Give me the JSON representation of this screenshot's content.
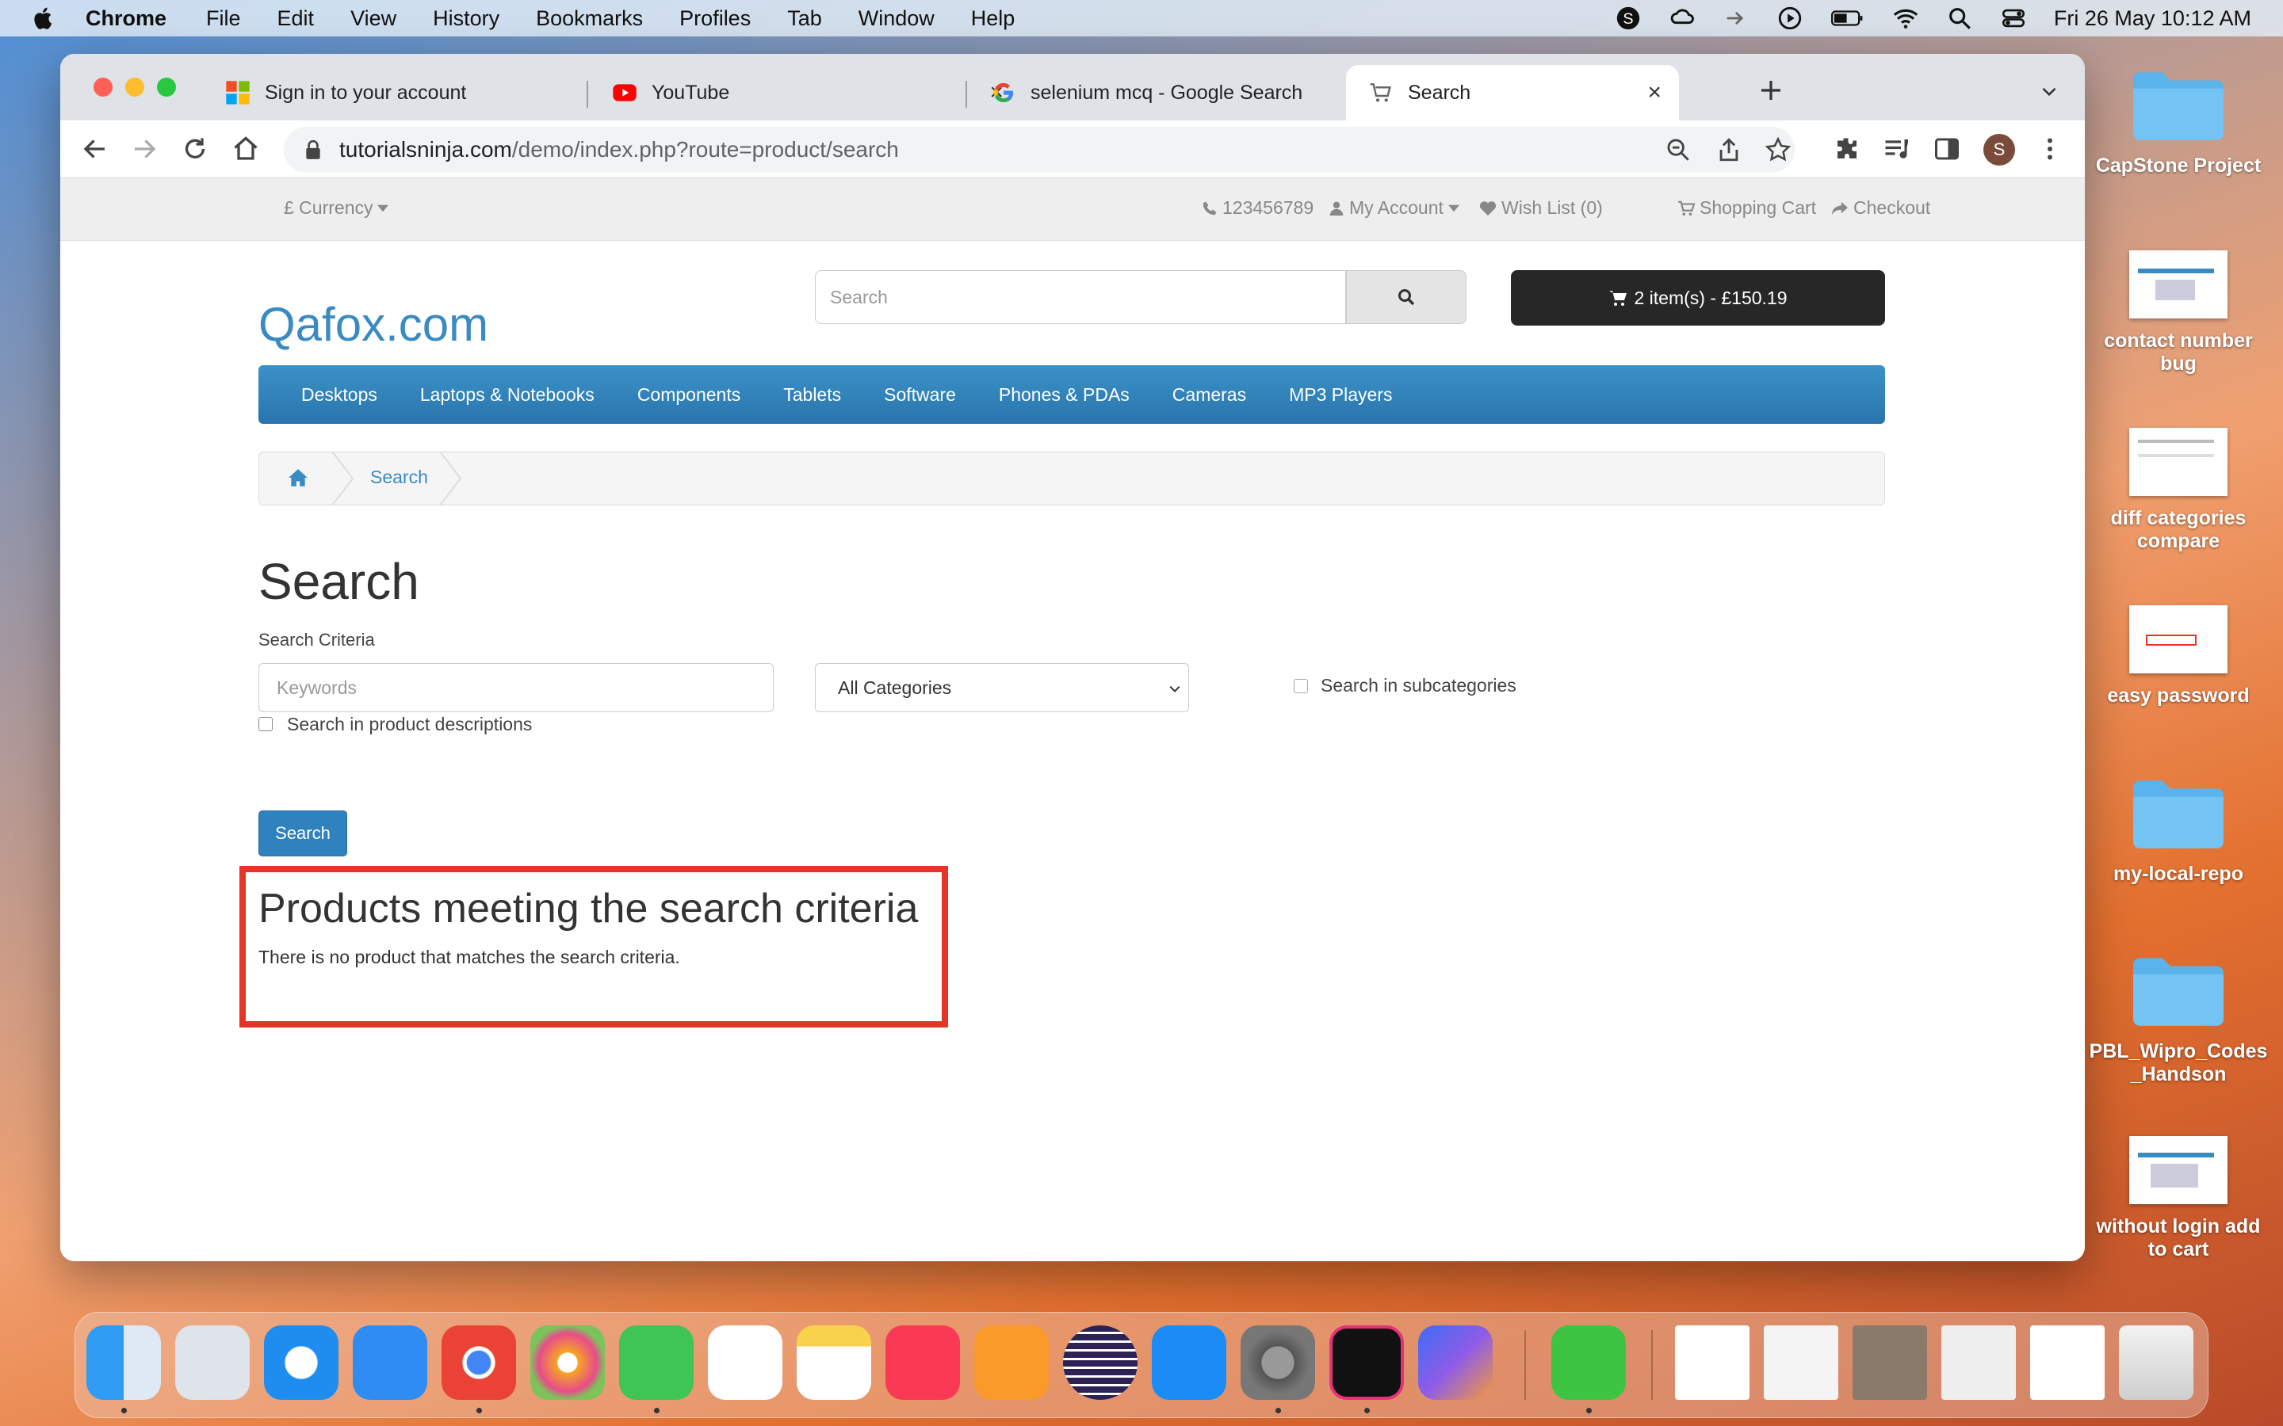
{
  "menubar": {
    "app_name": "Chrome",
    "items": [
      "File",
      "Edit",
      "View",
      "History",
      "Bookmarks",
      "Profiles",
      "Tab",
      "Window",
      "Help"
    ],
    "clock": "Fri 26 May  10:12 AM"
  },
  "browser": {
    "tabs": [
      {
        "title": "Sign in to your account",
        "icon": "microsoft-icon"
      },
      {
        "title": "YouTube",
        "icon": "youtube-icon"
      },
      {
        "title": "selenium mcq - Google Search",
        "icon": "google-icon"
      },
      {
        "title": "Search",
        "icon": "cart-favicon",
        "active": true
      }
    ],
    "url_domain": "tutorialsninja.com",
    "url_path": "/demo/index.php?route=product/search",
    "profile_initial": "S"
  },
  "site": {
    "topbar": {
      "currency": "£ Currency",
      "phone": "123456789",
      "my_account": "My Account",
      "wishlist": "Wish List (0)",
      "cart": "Shopping Cart",
      "checkout": "Checkout"
    },
    "logo": "Qafox.com",
    "search_placeholder": "Search",
    "cart_button": "2 item(s) - £150.19",
    "menu": [
      "Desktops",
      "Laptops & Notebooks",
      "Components",
      "Tablets",
      "Software",
      "Phones & PDAs",
      "Cameras",
      "MP3 Players"
    ],
    "breadcrumb": [
      "Search"
    ],
    "page_title": "Search",
    "criteria_label": "Search Criteria",
    "keywords_placeholder": "Keywords",
    "category_selected": "All Categories",
    "subcategories_label": "Search in subcategories",
    "descriptions_label": "Search in product descriptions",
    "search_button": "Search",
    "results_heading": "Products meeting the search criteria",
    "results_message": "There is no product that matches the search criteria."
  },
  "desktop_icons": [
    {
      "label": "CapStone Project",
      "kind": "folder"
    },
    {
      "label": "contact number bug",
      "kind": "screenshot"
    },
    {
      "label": "diff categories compare",
      "kind": "screenshot"
    },
    {
      "label": "easy password",
      "kind": "screenshot"
    },
    {
      "label": "my-local-repo",
      "kind": "folder"
    },
    {
      "label": "PBL_Wipro_Codes _Handson",
      "kind": "folder"
    },
    {
      "label": "without login add to cart",
      "kind": "screenshot"
    }
  ],
  "dock": [
    "finder-icon",
    "launchpad-icon",
    "safari-icon",
    "mail-icon",
    "chrome-icon",
    "photos-icon",
    "facetime-icon",
    "reminders-icon",
    "notes-icon",
    "music-icon",
    "pages-icon",
    "eclipse-icon",
    "app-store-icon",
    "system-settings-icon",
    "intellij-icon",
    "copilot-icon",
    "numbers-icon",
    "trash-icon"
  ],
  "colors": {
    "link_blue": "#3a8bc2",
    "menu_blue": "#2f82bd",
    "highlight_red": "#e53527",
    "cart_dark": "#272727"
  }
}
